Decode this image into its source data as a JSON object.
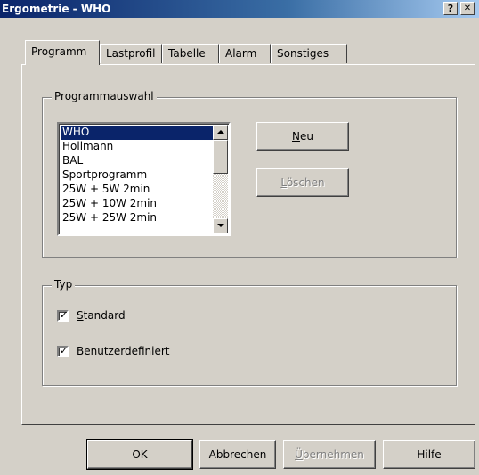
{
  "window": {
    "title": "Ergometrie - WHO",
    "help_button": "?",
    "close_button": "✕"
  },
  "tabs": [
    {
      "label": "Programm",
      "active": true
    },
    {
      "label": "Lastprofil",
      "active": false
    },
    {
      "label": "Tabelle",
      "active": false
    },
    {
      "label": "Alarm",
      "active": false
    },
    {
      "label": "Sonstiges",
      "active": false
    }
  ],
  "programmauswahl": {
    "group_label": "Programmauswahl",
    "items": [
      "WHO",
      "Hollmann",
      "BAL",
      "Sportprogramm",
      "25W + 5W 2min",
      "25W + 10W 2min",
      "25W + 25W 2min"
    ],
    "selected": "WHO",
    "buttons": {
      "neu": {
        "pre": "",
        "key": "N",
        "post": "eu"
      },
      "loeschen": {
        "pre": "",
        "key": "L",
        "post": "öschen"
      }
    }
  },
  "typ": {
    "group_label": "Typ",
    "standard": {
      "pre": "",
      "key": "S",
      "post": "tandard",
      "checked": true
    },
    "benutzerdefiniert": {
      "pre": "Be",
      "key": "n",
      "post": "utzerdefiniert",
      "checked": true
    }
  },
  "footer": {
    "ok": "OK",
    "abbrechen": "Abbrechen",
    "uebernehmen": {
      "pre": "",
      "key": "Ü",
      "post": "bernehmen"
    },
    "hilfe": "Hilfe"
  },
  "colors": {
    "face": "#d4d0c8",
    "title_start": "#0a246a",
    "title_end": "#a6caf0",
    "selection": "#0a246a"
  }
}
